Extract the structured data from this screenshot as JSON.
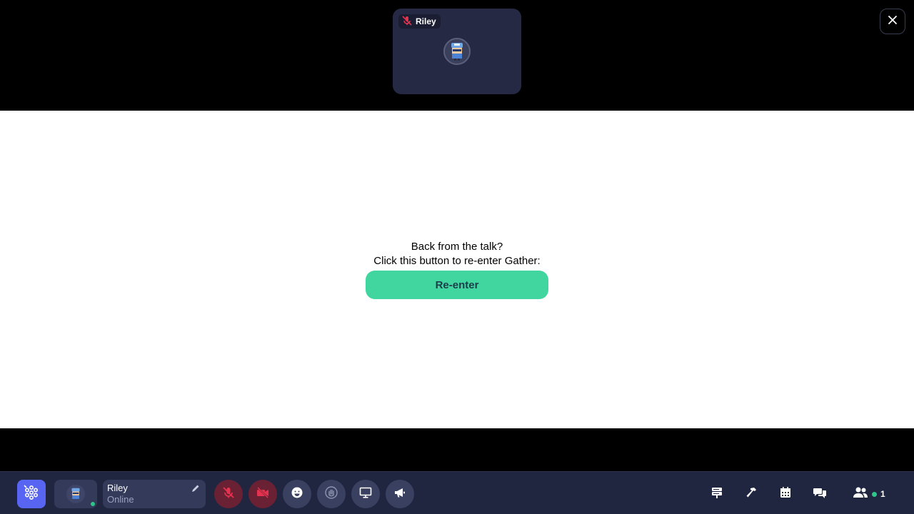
{
  "top": {
    "tile_name": "Riley",
    "close_icon": "close-icon"
  },
  "center": {
    "line1": "Back from the talk?",
    "line2": "Click this button to re-enter Gather:",
    "reenter_label": "Re-enter"
  },
  "bottom": {
    "user_name": "Riley",
    "user_status": "Online",
    "participant_count": "1",
    "icons": [
      "gather-logo-icon",
      "mic-off-icon",
      "camera-off-icon",
      "emoji-icon",
      "wave-hand-icon",
      "screen-share-icon",
      "megaphone-icon",
      "signpost-icon",
      "build-hammer-icon",
      "calendar-icon",
      "chat-icon",
      "participants-icon"
    ]
  },
  "colors": {
    "accent_green": "#41d6a0",
    "brand_blue": "#5865f2",
    "muted_red": "#e5334f",
    "bar_bg": "#202540"
  }
}
